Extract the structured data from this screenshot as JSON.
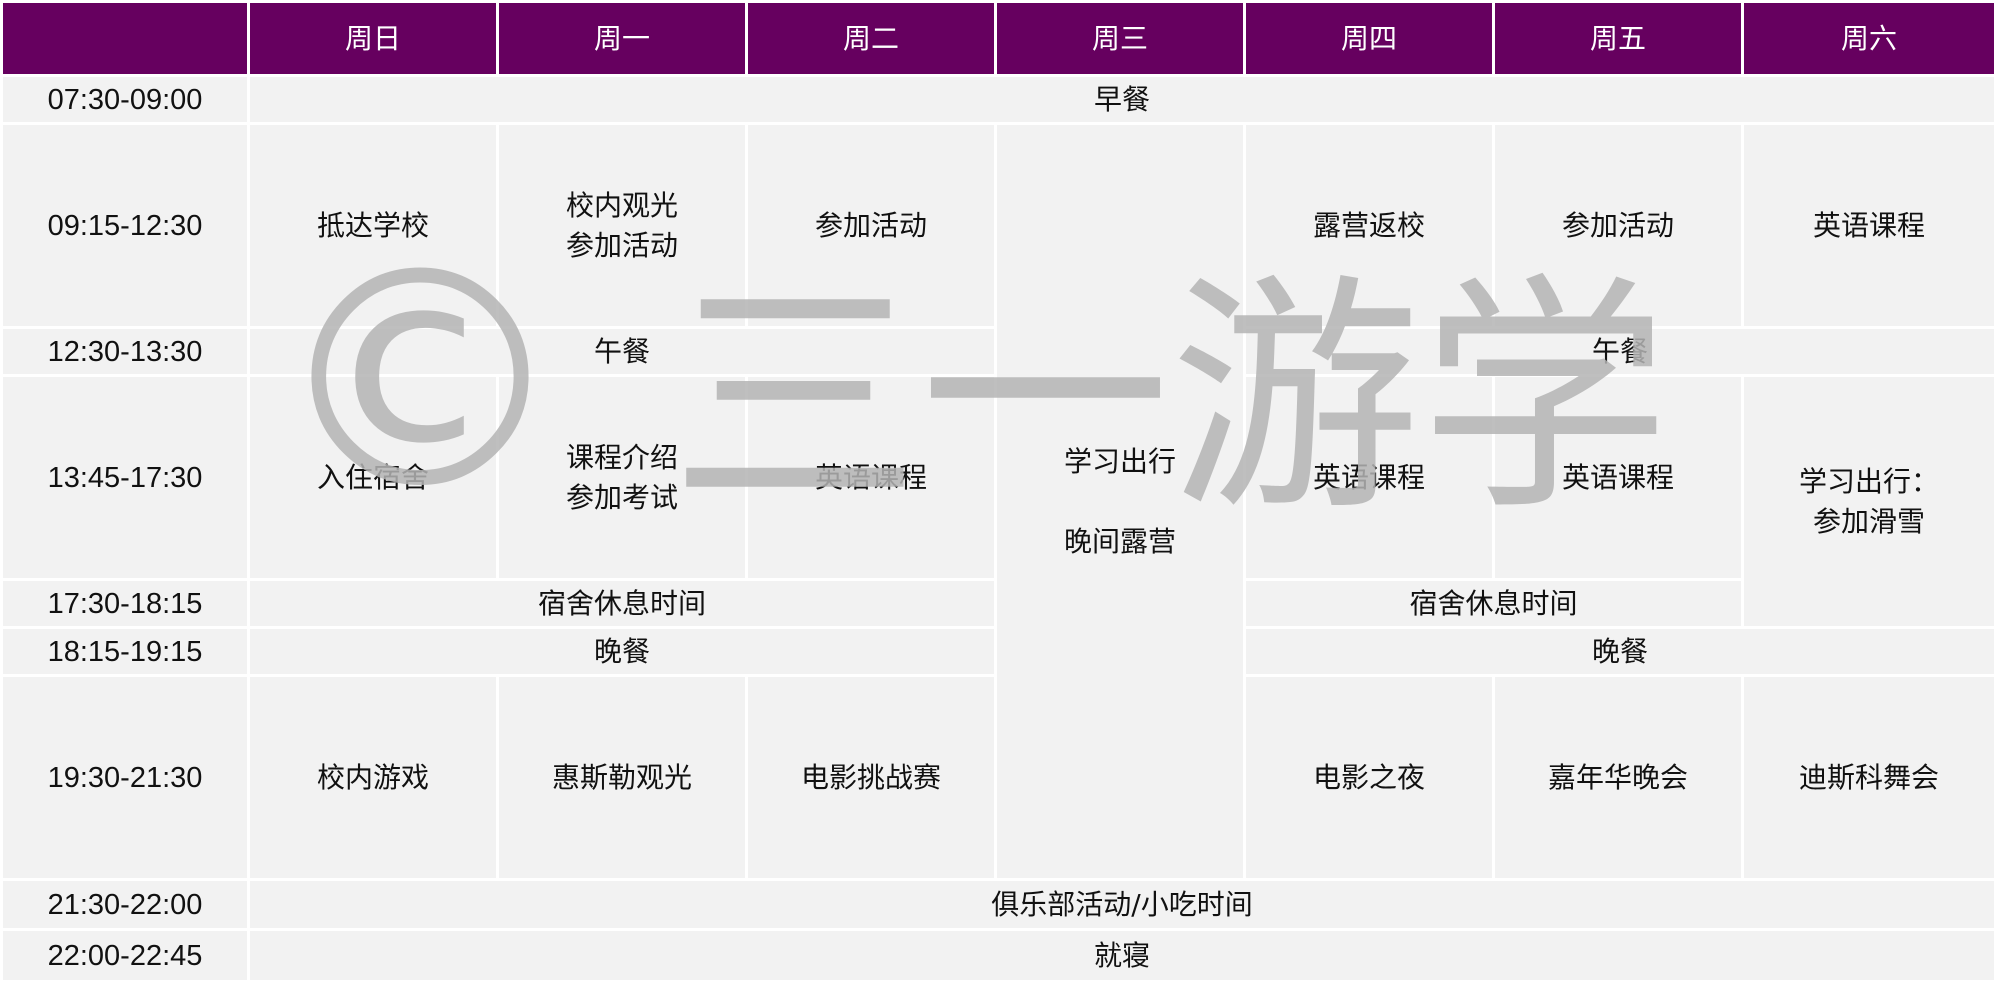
{
  "watermark": {
    "mark": "©",
    "text": "三一游学",
    "color": "#b4b4b4"
  },
  "header": {
    "corner": "",
    "days": [
      "周日",
      "周一",
      "周二",
      "周三",
      "周四",
      "周五",
      "周六"
    ]
  },
  "colors": {
    "header_bg": "#66005f",
    "header_text": "#ffffff",
    "cell_bg": "#f2f2f2",
    "grid": "#ffffff"
  },
  "rows": {
    "breakfast": {
      "time": "07:30-09:00",
      "all": "早餐"
    },
    "morning": {
      "time": "09:15-12:30",
      "sun": "抵达学校",
      "mon": "校内观光\n参加活动",
      "tue": "参加活动",
      "thu": "露营返校",
      "fri": "参加活动",
      "sat": "英语课程"
    },
    "lunch": {
      "time": "12:30-13:30",
      "left": "午餐",
      "right": "午餐"
    },
    "afternoon": {
      "time": "13:45-17:30",
      "sun": "入住宿舍",
      "mon": "课程介绍\n参加考试",
      "tue": "英语课程",
      "wed_line1": "学习出行",
      "wed_line2": "晚间露营",
      "thu": "英语课程",
      "fri": "英语课程",
      "sat": "学习出行：\n参加滑雪"
    },
    "rest": {
      "time": "17:30-18:15",
      "left": "宿舍休息时间",
      "right": "宿舍休息时间"
    },
    "dinner": {
      "time": "18:15-19:15",
      "left": "晚餐",
      "right": "晚餐"
    },
    "evening": {
      "time": "19:30-21:30",
      "sun": "校内游戏",
      "mon": "惠斯勒观光",
      "tue": "电影挑战赛",
      "thu": "电影之夜",
      "fri": "嘉年华晚会",
      "sat": "迪斯科舞会"
    },
    "club": {
      "time": "21:30-22:00",
      "all": "俱乐部活动/小吃时间"
    },
    "sleep": {
      "time": "22:00-22:45",
      "all": "就寝"
    }
  }
}
